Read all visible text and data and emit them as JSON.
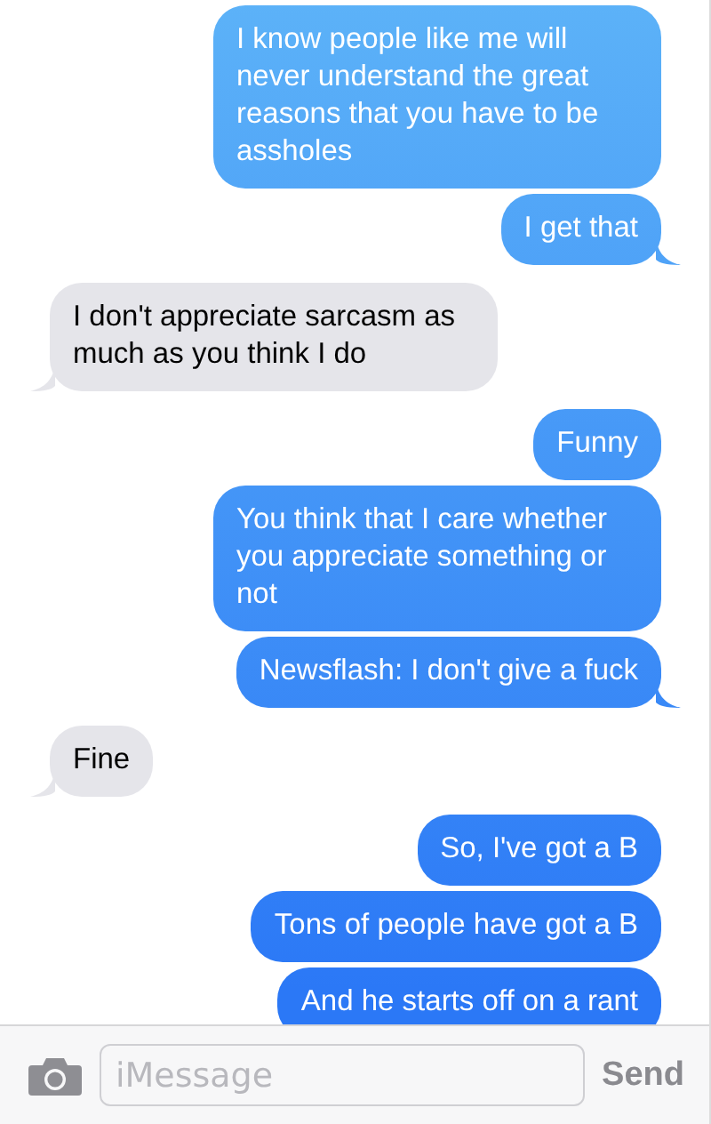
{
  "messages": [
    {
      "kind": "sent",
      "tail": false,
      "text": "I know people like me will never understand the great reasons that you have to be assholes"
    },
    {
      "kind": "sent",
      "tail": true,
      "text": "I get that"
    },
    {
      "kind": "received",
      "tail": true,
      "text": "I don't appreciate sarcasm as much as you think I do"
    },
    {
      "kind": "sent",
      "tail": false,
      "text": "Funny"
    },
    {
      "kind": "sent",
      "tail": false,
      "text": "You think that I care whether you appreciate something or not"
    },
    {
      "kind": "sent",
      "tail": true,
      "text": "Newsflash: I don't give a fuck"
    },
    {
      "kind": "received",
      "tail": true,
      "text": "Fine"
    },
    {
      "kind": "sent",
      "tail": false,
      "text": "So, I've got a B"
    },
    {
      "kind": "sent",
      "tail": false,
      "text": "Tons of people have got a B"
    },
    {
      "kind": "sent",
      "tail": false,
      "text": "And he starts off on a rant"
    }
  ],
  "composer": {
    "placeholder": "iMessage",
    "send": "Send",
    "send_disabled": true
  }
}
